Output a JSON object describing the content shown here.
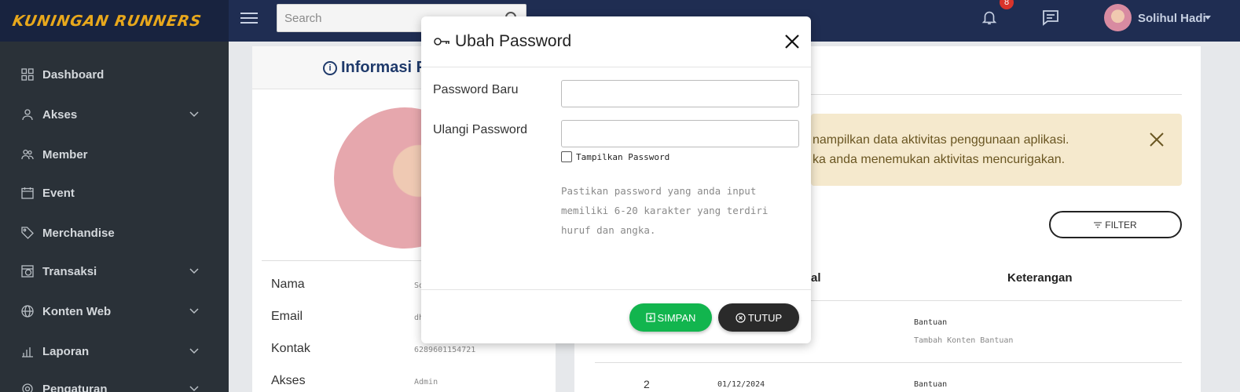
{
  "app": {
    "brand": "KUNINGAN RUNNERS"
  },
  "header": {
    "search_placeholder": "Search",
    "notif_count": "8",
    "user_name": "Solihul Hadi"
  },
  "sidebar": {
    "items": [
      {
        "label": "Dashboard",
        "icon": "grid-icon",
        "has_children": false
      },
      {
        "label": "Akses",
        "icon": "user-icon",
        "has_children": true
      },
      {
        "label": "Member",
        "icon": "users-icon",
        "has_children": false
      },
      {
        "label": "Event",
        "icon": "calendar-icon",
        "has_children": false
      },
      {
        "label": "Merchandise",
        "icon": "tag-icon",
        "has_children": false
      },
      {
        "label": "Transaksi",
        "icon": "transaction-icon",
        "has_children": true
      },
      {
        "label": "Konten Web",
        "icon": "globe-icon",
        "has_children": true
      },
      {
        "label": "Laporan",
        "icon": "chart-icon",
        "has_children": true
      },
      {
        "label": "Pengaturan",
        "icon": "gear-icon",
        "has_children": true
      }
    ]
  },
  "profile_card": {
    "title": "Informasi P",
    "rows": [
      {
        "label": "Nama",
        "value": "So"
      },
      {
        "label": "Email",
        "value": "dh"
      },
      {
        "label": "Kontak",
        "value": "6289601154721"
      },
      {
        "label": "Akses",
        "value": "Admin"
      }
    ]
  },
  "activity_card": {
    "alert_line1": "nampilkan data aktivitas penggunaan aplikasi.",
    "alert_line2": "ka anda menemukan aktivitas mencurigakan.",
    "filter_label": "FILTER",
    "col_tanggal": "al",
    "col_keterangan": "Keterangan",
    "rows": [
      {
        "no": "",
        "date": "",
        "ket": "Bantuan",
        "sub": "Tambah Konten Bantuan"
      },
      {
        "no": "2",
        "date": "01/12/2024",
        "ket": "Bantuan",
        "sub": ""
      }
    ]
  },
  "modal": {
    "title": "Ubah Password",
    "field_new_label": "Password Baru",
    "field_new_value": "",
    "field_repeat_label": "Ulangi Password",
    "field_repeat_value": "",
    "show_password_label": "Tampilkan Password",
    "show_password_checked": false,
    "hint": "Pastikan password yang anda input memiliki 6-20 karakter yang terdiri huruf dan angka.",
    "save_label": "SIMPAN",
    "close_label": "TUTUP"
  },
  "colors": {
    "topbar": "#1f2d52",
    "sidebar": "#2a3138",
    "brand": "#e8a81c",
    "save": "#12b54e",
    "close": "#2a2a2a"
  }
}
